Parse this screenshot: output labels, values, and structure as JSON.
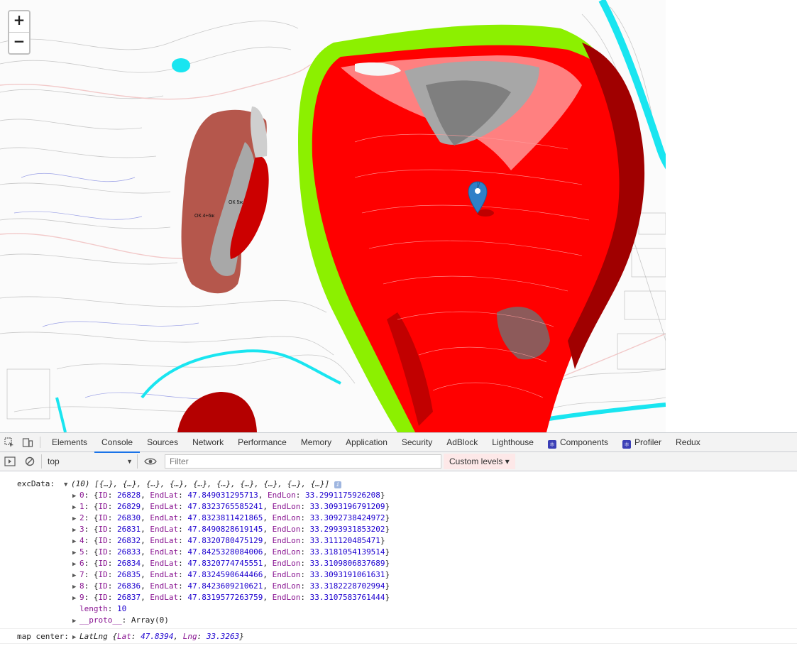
{
  "map": {
    "zoom_in_label": "+",
    "zoom_out_label": "−",
    "labels": [
      "ОК 4+6ж",
      "ОК 5ж"
    ]
  },
  "devtools": {
    "tabs": [
      "Elements",
      "Console",
      "Sources",
      "Network",
      "Performance",
      "Memory",
      "Application",
      "Security",
      "AdBlock",
      "Lighthouse",
      "Components",
      "Profiler",
      "Redux"
    ],
    "active_tab": "Console",
    "context": "top",
    "filter_placeholder": "Filter",
    "levels_label": "Custom levels ▾"
  },
  "console": {
    "exc_label": "excData:",
    "exc_summary": "(10) [{…}, {…}, {…}, {…}, {…}, {…}, {…}, {…}, {…}, {…}]",
    "rows": [
      {
        "i": "0",
        "id": "26828",
        "lat": "47.849031295713",
        "lon": "33.2991175926208"
      },
      {
        "i": "1",
        "id": "26829",
        "lat": "47.8323765585241",
        "lon": "33.3093196791209"
      },
      {
        "i": "2",
        "id": "26830",
        "lat": "47.8323811421865",
        "lon": "33.3092738424972"
      },
      {
        "i": "3",
        "id": "26831",
        "lat": "47.8490828619145",
        "lon": "33.2993931853202"
      },
      {
        "i": "4",
        "id": "26832",
        "lat": "47.8320780475129",
        "lon": "33.311120485471"
      },
      {
        "i": "5",
        "id": "26833",
        "lat": "47.8425328084006",
        "lon": "33.3181054139514"
      },
      {
        "i": "6",
        "id": "26834",
        "lat": "47.8320774745551",
        "lon": "33.3109806837689"
      },
      {
        "i": "7",
        "id": "26835",
        "lat": "47.8324590644466",
        "lon": "33.3093191061631"
      },
      {
        "i": "8",
        "id": "26836",
        "lat": "47.8423609210621",
        "lon": "33.3182228702994"
      },
      {
        "i": "9",
        "id": "26837",
        "lat": "47.8319577263759",
        "lon": "33.3107583761444"
      }
    ],
    "length_key": "length",
    "length_value": "10",
    "proto_key": "__proto__",
    "proto_value": "Array(0)",
    "map_center_label": "map center:",
    "latlng_type": "LatLng",
    "lat": "47.8394",
    "lng": "33.3263"
  }
}
